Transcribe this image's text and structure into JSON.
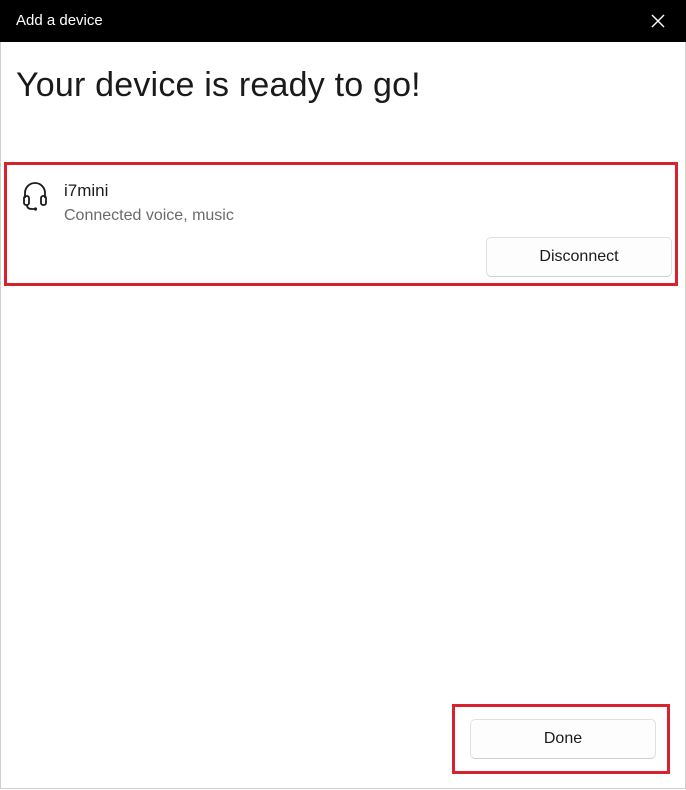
{
  "window": {
    "title": "Add a device"
  },
  "main": {
    "heading": "Your device is ready to go!"
  },
  "device": {
    "name": "i7mini",
    "status": "Connected voice, music",
    "disconnect_label": "Disconnect",
    "icon": "headset-icon"
  },
  "footer": {
    "done_label": "Done"
  },
  "colors": {
    "titlebar": "#000000",
    "highlight": "#d8232f"
  }
}
